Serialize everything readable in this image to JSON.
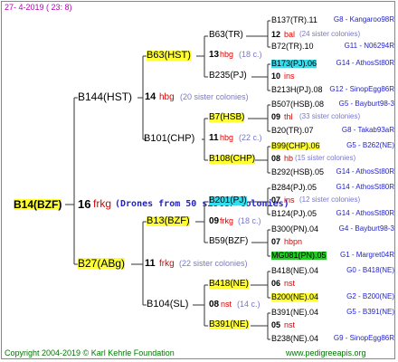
{
  "header": {
    "date": "27-  4-2019 ( 23:  8)"
  },
  "footer": {
    "copyright": "Copyright 2004-2019 © Karl Kehrle Foundation",
    "site": "www.pedigreeapis.org"
  },
  "colors": {
    "highlight": "#ffff33",
    "cyan": "#33ddee",
    "green": "#22cc22",
    "breeder": "#dd0000",
    "colonies": "#7777cc",
    "code": "#2222cc"
  },
  "root": {
    "name": "B14(BZF)",
    "year": "16",
    "breeder": "frkg",
    "note": "(Drones from 50 sister colonies)"
  },
  "gen2": [
    {
      "name": "B144(HST)",
      "year": "14",
      "breeder": "hbg",
      "colonies": "(20 sister colonies)"
    },
    {
      "name": "B27(ABg)",
      "year": "11",
      "breeder": "frkg",
      "colonies": "(22 sister colonies)"
    }
  ],
  "gen3": [
    {
      "name": "B63(HST)"
    },
    {
      "name": "B101(CHP)"
    },
    {
      "name": "B13(BZF)"
    },
    {
      "name": "B104(SL)"
    }
  ],
  "gen4": [
    {
      "name": "B63(TR)"
    },
    {
      "year": "13",
      "breeder": "hbg",
      "colonies": "(18 c.)"
    },
    {
      "name": "B235(PJ)"
    },
    {
      "name": "B7(HSB)"
    },
    {
      "year": "11",
      "breeder": "hbg",
      "colonies": "(22 c.)"
    },
    {
      "name": "B108(CHP)"
    },
    {
      "name": "B201(PJ)"
    },
    {
      "year": "09",
      "breeder": "frkg",
      "colonies": "(18 c.)"
    },
    {
      "name": "B59(BZF)"
    },
    {
      "name": "B418(NE)"
    },
    {
      "year": "08",
      "breeder": "nst",
      "colonies": "(14 c.)"
    },
    {
      "name": "B391(NE)"
    }
  ],
  "gen5": [
    {
      "a": "B137(TR).11",
      "b": "G8 - Kangaroo98R"
    },
    {
      "year": "12",
      "breeder": "bal",
      "colonies": "(24 sister colonies)"
    },
    {
      "a": "B72(TR).10",
      "b": "G11 - N06294R"
    },
    {
      "a": "B173(PJ).06",
      "b": "G14 - AthosSt80R",
      "hl": "cy"
    },
    {
      "year": "10",
      "breeder": "ins",
      "colonies": ""
    },
    {
      "a": "B213H(PJ).08",
      "b": "G12 - SinopEgg86R"
    },
    {
      "a": "B507(HSB).08",
      "b": "G5 - Bayburt98-3"
    },
    {
      "year": "09",
      "breeder": "thl",
      "colonies": "(33 sister colonies)"
    },
    {
      "a": "B20(TR).07",
      "b": "G8 - Takab93aR"
    },
    {
      "a": "B99(CHP).06",
      "b": "G5 - B262(NE)",
      "hl": "hl"
    },
    {
      "year": "08",
      "breeder": "hb",
      "colonies": "(15 sister colonies)"
    },
    {
      "a": "B292(HSB).05",
      "b": "G14 - AthosSt80R"
    },
    {
      "a": "B284(PJ).05",
      "b": "G14 - AthosSt80R"
    },
    {
      "year": "07",
      "breeder": "ins",
      "colonies": "(12 sister colonies)"
    },
    {
      "a": "B124(PJ).05",
      "b": "G14 - AthosSt80R"
    },
    {
      "a": "B300(PN).04",
      "b": "G4 - Bayburt98-3"
    },
    {
      "year": "07",
      "breeder": "hbpn",
      "colonies": ""
    },
    {
      "a": "MG081(PN).05",
      "b": "G1 - Margret04R",
      "hl": "gr"
    },
    {
      "a": "B418(NE).04",
      "b": "G0 - B418(NE)"
    },
    {
      "year": "06",
      "breeder": "nst",
      "colonies": ""
    },
    {
      "a": "B200(NE).04",
      "b": "G2 - B200(NE)",
      "hl": "hl"
    },
    {
      "a": "B391(NE).04",
      "b": "G5 - B391(NE)"
    },
    {
      "year": "05",
      "breeder": "nst",
      "colonies": ""
    },
    {
      "a": "B238(NE).04",
      "b": "G9 - SinopEgg86R"
    }
  ]
}
